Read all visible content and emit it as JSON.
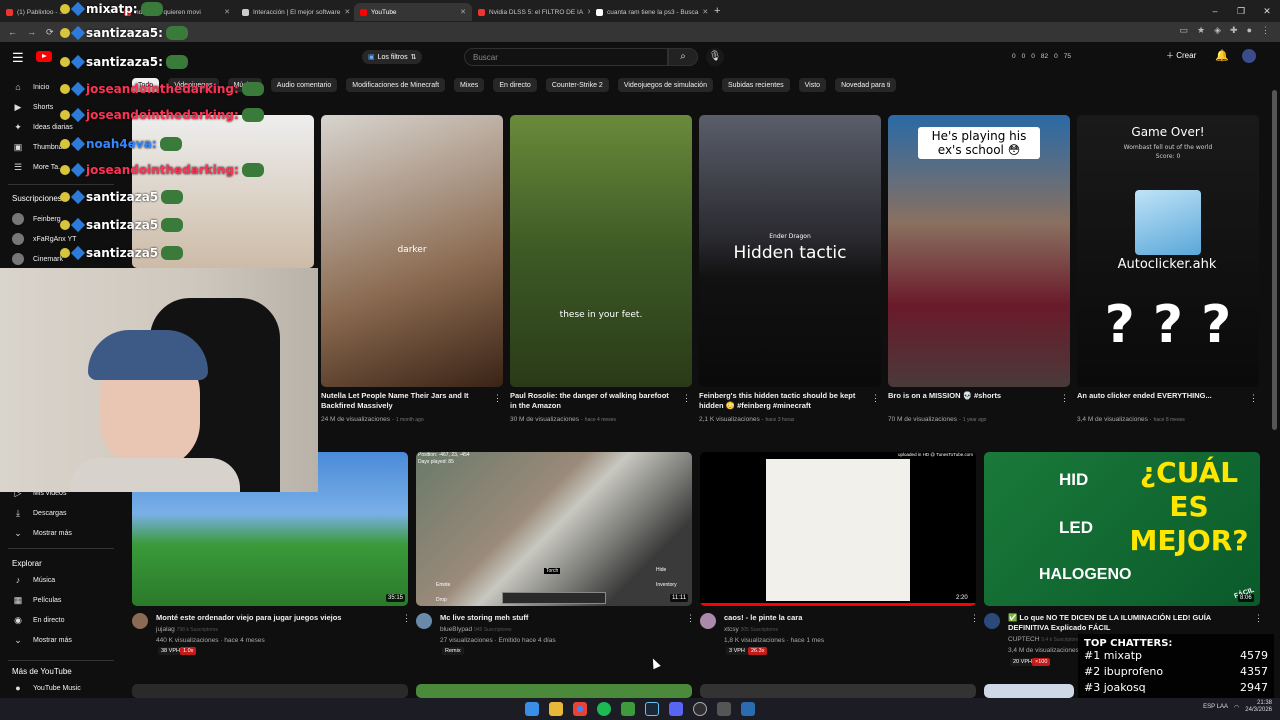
{
  "browser": {
    "tabs": [
      {
        "label": "(1) Pablixtoo - ...",
        "color": "#e33"
      },
      {
        "label": "ndos que quieren movi",
        "color": "#e33"
      },
      {
        "label": "Interacción | El mejor software",
        "color": "#ccc"
      },
      {
        "label": "YouTube",
        "color": "#f00"
      },
      {
        "label": "Nvidia DLSS 5: el FILTRO DE IA",
        "color": "#e33"
      },
      {
        "label": "cuanta ram tiene la ps3 - Busca",
        "color": "#fff"
      }
    ],
    "active_tab_index": 3,
    "window_controls": [
      "–",
      "❐",
      "✕"
    ]
  },
  "header": {
    "search_placeholder": "Buscar",
    "filter_label": "Los filtros",
    "stats": [
      "0",
      "0",
      "0",
      "82",
      "0",
      "75"
    ],
    "create_label": "Crear"
  },
  "chips": [
    "Todo",
    "Videojuegos",
    "Música",
    "Audio comentario",
    "Modificaciones de Minecraft",
    "Mixes",
    "En directo",
    "Counter-Strike 2",
    "Videojuegos de simulación",
    "Subidas recientes",
    "Visto",
    "Novedad para ti"
  ],
  "sidebar": {
    "top": [
      {
        "label": "Inicio",
        "icon": "home-icon"
      },
      {
        "label": "Shorts",
        "icon": "shorts-icon"
      },
      {
        "label": "Ideas diarias",
        "icon": "ideas-icon"
      },
      {
        "label": "Thumbnail",
        "icon": "thumbnail-icon"
      },
      {
        "label": "More Ta...",
        "icon": "more-icon"
      }
    ],
    "subs_title": "Suscripciones",
    "subs": [
      "Feinberg",
      "xFaRgAnx YT",
      "Cinemark"
    ],
    "you_items": [
      {
        "label": "Mis vídeos",
        "icon": "video-icon"
      },
      {
        "label": "Descargas",
        "icon": "download-icon"
      },
      {
        "label": "Mostrar más",
        "icon": "chevron-down-icon"
      }
    ],
    "explore_title": "Explorar",
    "explore": [
      {
        "label": "Música",
        "icon": "music-icon"
      },
      {
        "label": "Películas",
        "icon": "film-icon"
      },
      {
        "label": "En directo",
        "icon": "live-icon"
      },
      {
        "label": "Mostrar más",
        "icon": "chevron-down-icon"
      }
    ],
    "more_title": "Más de YouTube",
    "more": [
      {
        "label": "YouTube Music",
        "icon": "youtube-music-icon"
      }
    ]
  },
  "row1": [
    {
      "title": "Nutella Let People Name Their Jars and It Backfired Massively",
      "views": "24 M de visualizaciones",
      "ago": "1 month ago",
      "overlay": "darker"
    },
    {
      "title": "Paul Rosolie: the danger of walking barefoot in the Amazon",
      "views": "30 M de visualizaciones",
      "ago": "hace 4 meses",
      "overlay": "these in your feet."
    },
    {
      "title": "Feinberg's this hidden tactic should be kept hidden 😳 #feinberg #minecraft",
      "views": "2,1 K visualizaciones",
      "ago": "hace 3 horas",
      "overlay": "Hidden tactic",
      "overlay2": "Ender Dragon"
    },
    {
      "title": "Bro is on a MISSION 💀 #shorts",
      "views": "70 M de visualizaciones",
      "ago": "1 year ago",
      "overlay": "He's playing his ex's school 😳"
    },
    {
      "title": "An auto clicker ended EVERYTHING...",
      "views": "3,4 M de visualizaciones",
      "ago": "hace 8 meses",
      "overlay": "Game Over!",
      "overlay2": "Wombast fell out of the world",
      "overlay3": "Score: 0",
      "overlay4": "Autoclicker.ahk",
      "overlay5": "? ? ?"
    }
  ],
  "row2": [
    {
      "title": "Monté este ordenador viejo para jugar juegos viejos",
      "channel": "jujalag",
      "subs": "798 k Suscriptores",
      "views": "440 K visualizaciones · hace 4 meses",
      "duration": "35:15",
      "badges": [
        "38 VPH",
        "1.0x"
      ]
    },
    {
      "title": "Mc live storing meh stuff",
      "channel": "blueBlypad",
      "subs": "945 Suscriptores",
      "views": "27 visualizaciones · Emitido hace 4 días",
      "duration": "11:11",
      "badges": [
        "Remix"
      ],
      "hud_top": "Position: -467, 23, -454",
      "hud_days": "Days played: 85",
      "hud_item": "Torch",
      "hud_emote": "Emote",
      "hud_drop": "Drop",
      "hud_inv": "Inventory",
      "hud_hide": "Hide"
    },
    {
      "title": "caos! - le pinte la cara",
      "channel": "xtcsy",
      "subs": "305 Suscriptores",
      "views": "1,8 K visualizaciones · hace 1 mes",
      "duration": "2:20",
      "badges": [
        "3 VPH",
        "26.3x"
      ],
      "uploaded": "uploaded in HD @ TunesToTube.com"
    },
    {
      "title": "✅ Lo que NO TE DICEN DE LA ILUMINACIÓN LED! GUÍA DEFINITIVA Explicado FÁCIL",
      "channel": "CUPTECH",
      "subs": "9,4 k Suscriptores",
      "views": "3,4 M de visualizaciones",
      "duration": "8:06",
      "badges": [
        "20 VPH",
        "×100"
      ],
      "overlay_q": "¿CUÁL ES MEJOR?",
      "labels": [
        "HID",
        "LED",
        "HALOGENO"
      ],
      "tag": "FÁCIL"
    }
  ],
  "chat_overlay": [
    {
      "user": "mixatp:",
      "color": "#ffffff"
    },
    {
      "user": "santizaza5:",
      "color": "#ffffff"
    },
    {
      "user": "santizaza5:",
      "color": "#ffffff"
    },
    {
      "user": "joseandointhedarking:",
      "color": "#ff3355"
    },
    {
      "user": "joseandointhedarking:",
      "color": "#ff3355"
    },
    {
      "user": "noah4eva:",
      "color": "#3388ff"
    },
    {
      "user": "joseandointhedarking:",
      "color": "#ff3355"
    },
    {
      "user": "santizaza5",
      "color": "#ffffff"
    },
    {
      "user": "santizaza5",
      "color": "#ffffff"
    },
    {
      "user": "santizaza5",
      "color": "#ffffff"
    }
  ],
  "top_chatters": {
    "title": "TOP CHATTERS:",
    "rows": [
      {
        "rank": "#1",
        "name": "mixatp",
        "count": "4579"
      },
      {
        "rank": "#2",
        "name": "ibuprofeno",
        "count": "4357"
      },
      {
        "rank": "#3",
        "name": "joakosq",
        "count": "2947"
      }
    ]
  },
  "tray": {
    "lang": "ESP LAA",
    "time": "21:38",
    "date": "24/3/2026"
  }
}
